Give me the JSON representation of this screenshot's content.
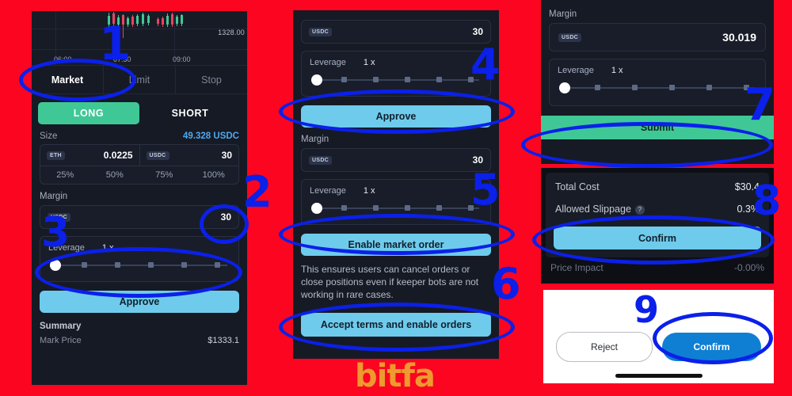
{
  "meta": {
    "background_color": "#fb0521",
    "annotation_color": "#0b20e8",
    "accent_cyan": "#6fcbec",
    "accent_green": "#3fc896",
    "accent_blue": "#0f7fd4",
    "logo_color": "#ee9a2e",
    "logo_text": "bitfa"
  },
  "panel1": {
    "chart": {
      "price_label": "1328.00",
      "time_labels": [
        "06:00",
        "07:30",
        "09:00"
      ]
    },
    "order_tabs": [
      {
        "label": "Market",
        "active": true
      },
      {
        "label": "Limit",
        "active": false
      },
      {
        "label": "Stop",
        "active": false
      }
    ],
    "side_buttons": [
      {
        "label": "LONG",
        "active": true
      },
      {
        "label": "SHORT",
        "active": false
      }
    ],
    "size": {
      "label": "Size",
      "value": "49.328 USDC",
      "base_chip": "ETH",
      "base_value": "0.0225",
      "quote_chip": "USDC",
      "quote_value": "30",
      "percents": [
        "25%",
        "50%",
        "75%",
        "100%"
      ]
    },
    "margin": {
      "label": "Margin",
      "chip": "USDC",
      "value": "30"
    },
    "leverage": {
      "label": "Leverage",
      "value": "1 x"
    },
    "approve_button": "Approve",
    "summary": {
      "title": "Summary",
      "rows": [
        {
          "label": "Mark Price",
          "value": "$1333.1"
        }
      ]
    }
  },
  "panel2": {
    "top_margin_input": {
      "chip": "USDC",
      "value": "30"
    },
    "leverage_top": {
      "label": "Leverage",
      "value": "1 x"
    },
    "approve_button": "Approve",
    "margin_label": "Margin",
    "margin_input": {
      "chip": "USDC",
      "value": "30"
    },
    "leverage_bottom": {
      "label": "Leverage",
      "value": "1 x"
    },
    "enable_market_order_button": "Enable market order",
    "note": "This ensures users can cancel orders or close positions even if keeper bots are not working in rare cases.",
    "accept_terms_button": "Accept terms and enable orders"
  },
  "panel3": {
    "margin_label": "Margin",
    "margin_input": {
      "chip": "USDC",
      "value": "30.019"
    },
    "leverage": {
      "label": "Leverage",
      "value": "1 x"
    },
    "submit_button": "Submit"
  },
  "panel4": {
    "rows": [
      {
        "label": "Total Cost",
        "value": "$30.4",
        "help": false
      },
      {
        "label": "Allowed Slippage",
        "value": "0.3%",
        "help": true
      }
    ],
    "help_glyph": "?",
    "confirm_button": "Confirm",
    "price_impact": {
      "label": "Price Impact",
      "value": "-0.00%"
    }
  },
  "panel5": {
    "reject_button": "Reject",
    "confirm_button": "Confirm"
  },
  "annotations": [
    {
      "number": "1"
    },
    {
      "number": "2"
    },
    {
      "number": "3"
    },
    {
      "number": "4"
    },
    {
      "number": "5"
    },
    {
      "number": "6"
    },
    {
      "number": "7"
    },
    {
      "number": "8"
    },
    {
      "number": "9"
    }
  ]
}
